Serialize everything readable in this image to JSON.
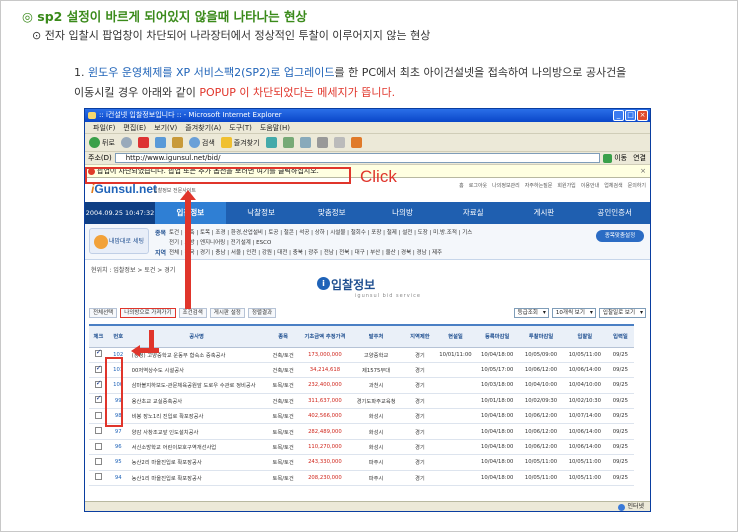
{
  "heading": "◎ sp2 설정이 바르게 되어있지 않을때 나타나는 현상",
  "subheading": "⊙ 전자 입찰시 팝업창이 차단되어 나라장터에서 정상적인 투찰이 이루어지지 않는 현상",
  "para": {
    "num": "1.",
    "blue": "윈도우 운영체제를 XP 서비스팩2(SP2)로 업그레이드",
    "mid": "를 한 PC에서 최초 아이건설넷을 접속하여 나의방으로 공사건을",
    "line2": "이동시킬 경우 아래와 같이 ",
    "red": "POPUP 이 차단되었다는 메세지가 뜹니다."
  },
  "annotation": {
    "click": "Click"
  },
  "ie": {
    "title": ":: i건설넷 입찰정보입니다 :: - Microsoft Internet Explorer",
    "menu": [
      "파일(F)",
      "편집(E)",
      "보기(V)",
      "즐겨찾기(A)",
      "도구(T)",
      "도움말(H)"
    ],
    "toolbar": {
      "back": "뒤로",
      "search": "검색",
      "favorites": "즐겨찾기"
    },
    "address_label": "주소(D)",
    "address": "http://www.igunsul.net/bid/",
    "go": "이동",
    "links": "연결",
    "infobar": "팝업이 차단되었습니다. 팝업 또는 추가 옵션을 보려면 여기를 클릭하십시오.",
    "status": "인터넷"
  },
  "site": {
    "logo_i": "i",
    "logo": "Gunsul.net",
    "logo_sub": "입찰정보 전문사이트",
    "toplinks": [
      "홈",
      "로그아웃",
      "나의정보관리",
      "자주하는질문",
      "회원가입",
      "이용안내",
      "업체검색",
      "문의하기"
    ],
    "date": "2004.09.25 10:47:32",
    "nav": [
      "입찰정보",
      "낙찰정보",
      "맞춤정보",
      "나의방",
      "자료실",
      "게시판",
      "공인인증서"
    ],
    "my_service": "내맘대로 세팅",
    "cat1_label": "종목",
    "cat1": "토건 | 건축 | 토목 | 조경 | 환경,산업설비 | 토공 | 철콘 | 석공 | 상하 | 시설물 | 철회수 | 포장 | 철제 | 설전 | 도장 | 미.방.조적 | 기스",
    "cat2": "전기 | 소방 | 엔지니어링 | 전기설계 | ESCO",
    "cat3_label": "지역",
    "cat3": "전체 | 전국 | 경기 | 충남 | 서울 | 인천 | 강원 | 대전 | 충북 | 광주 | 전남 | 전북 | 대구 | 부산 | 울산 | 경북 | 경남 | 제주",
    "cat_button": "종목맞춤설정",
    "crumb": "현위치 : 입찰정보 > 토건 > 경기",
    "page_title": "입찰정보",
    "page_sub": "igunsul bid service",
    "ctrls": [
      "전체선택",
      "나의방으로 가져가기",
      "조건검색",
      "게시판 설정",
      "정렬결과"
    ],
    "selects": [
      "등급조회",
      "10개씩 보기",
      "입찰일로 보기"
    ],
    "columns": [
      "체크",
      "번호",
      "공사명",
      "종목",
      "기초금액\n추정가격",
      "발주처",
      "지역제한",
      "현설일",
      "등록마감일",
      "투찰마감일",
      "입찰일",
      "입력일"
    ],
    "rows": [
      {
        "checked": true,
        "no": "102",
        "name": "(정정) 고양중학교 운동부 합숙소 증축공사",
        "type": "건축/토건",
        "amount": "173,000,000",
        "org": "고양중학교",
        "region": "경기",
        "site": "10/01/11:00",
        "reg": "10/04/18:00",
        "bid": "10/05/09:00",
        "open": "10/05/11:00",
        "input": "09/25"
      },
      {
        "checked": true,
        "no": "101",
        "name": "00저역상수도 시설공사",
        "type": "건축/토건",
        "amount": "34,214,618",
        "org": "제1575부대",
        "region": "경기",
        "site": "",
        "reg": "10/05/17:00",
        "bid": "10/06/12:00",
        "open": "10/06/14:00",
        "input": "09/25"
      },
      {
        "checked": true,
        "no": "100",
        "name": "삼마볼지하보도-관문체육공원앞 도로우 수관로 정비공사",
        "type": "토목/토건",
        "amount": "232,400,000",
        "org": "과천시",
        "region": "경기",
        "site": "",
        "reg": "10/03/18:00",
        "bid": "10/04/10:00",
        "open": "10/04/10:00",
        "input": "09/25"
      },
      {
        "checked": true,
        "no": "99",
        "name": "용산초교 교실증축공사",
        "type": "건축/토건",
        "amount": "311,637,000",
        "org": "경기도파주교육청",
        "region": "경기",
        "site": "",
        "reg": "10/01/18:00",
        "bid": "10/02/09:30",
        "open": "10/02/10:30",
        "input": "09/25"
      },
      {
        "checked": false,
        "no": "98",
        "name": "비봉 장노1리 진입로 확포장공사",
        "type": "토목/토건",
        "amount": "402,566,000",
        "org": "화성시",
        "region": "경기",
        "site": "",
        "reg": "10/04/18:00",
        "bid": "10/06/12:00",
        "open": "10/07/14:00",
        "input": "09/25"
      },
      {
        "checked": false,
        "no": "97",
        "name": "양감 사창조교앞 인도설치공사",
        "type": "토목/토건",
        "amount": "282,489,000",
        "org": "화성시",
        "region": "경기",
        "site": "",
        "reg": "10/04/18:00",
        "bid": "10/06/12:00",
        "open": "10/06/14:00",
        "input": "09/25"
      },
      {
        "checked": false,
        "no": "96",
        "name": "서신소방학교 어린이보호구역개선사업",
        "type": "토목/토건",
        "amount": "110,270,000",
        "org": "화성시",
        "region": "경기",
        "site": "",
        "reg": "10/04/18:00",
        "bid": "10/06/12:00",
        "open": "10/06/14:00",
        "input": "09/25"
      },
      {
        "checked": false,
        "no": "95",
        "name": "농산2리 마을진입로 확포장공사",
        "type": "토목/토건",
        "amount": "243,330,000",
        "org": "파주시",
        "region": "경기",
        "site": "",
        "reg": "10/04/18:00",
        "bid": "10/05/11:00",
        "open": "10/05/11:00",
        "input": "09/25"
      },
      {
        "checked": false,
        "no": "94",
        "name": "농산1리 마을진입로 확포장공사",
        "type": "토목/토건",
        "amount": "208,230,000",
        "org": "파주시",
        "region": "경기",
        "site": "",
        "reg": "10/04/18:00",
        "bid": "10/05/11:00",
        "open": "10/05/11:00",
        "input": "09/25"
      }
    ]
  }
}
